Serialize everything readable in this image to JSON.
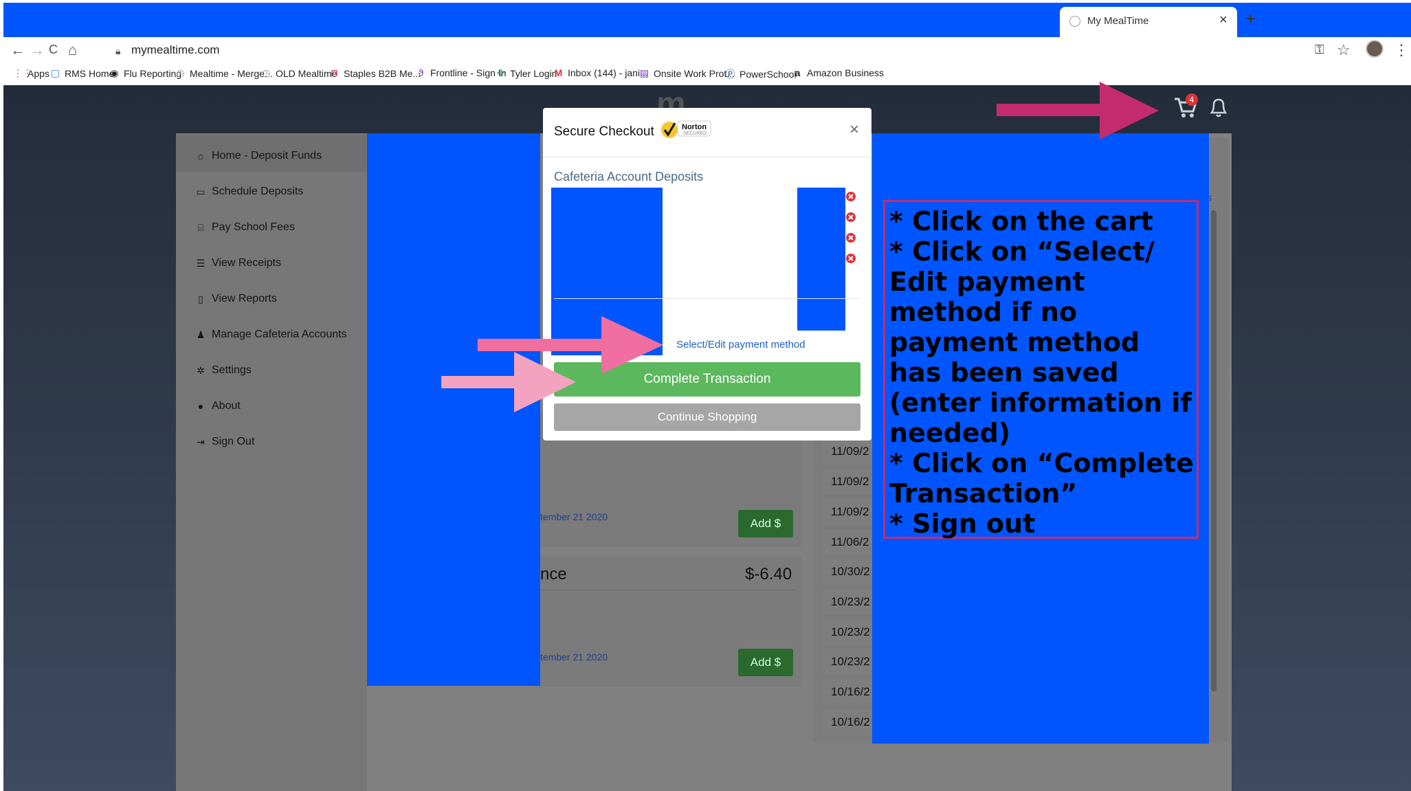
{
  "browser": {
    "tab_title": "My MealTime",
    "tab_close": "×",
    "new_tab": "+",
    "url": "mymealtime.com",
    "nav": {
      "back": "←",
      "forward": "→",
      "reload": "C",
      "home": "⌂"
    },
    "bookmarks": [
      {
        "label": "Apps",
        "icon": "apps-grid-icon"
      },
      {
        "label": "RMS Home",
        "icon": "page-icon"
      },
      {
        "label": "Flu Reporting",
        "icon": "globe-icon"
      },
      {
        "label": "Mealtime - Merge...",
        "icon": "clock-icon"
      },
      {
        "label": "OLD Mealtime",
        "icon": "clock-icon"
      },
      {
        "label": "Staples B2B Me...",
        "icon": "staples-icon"
      },
      {
        "label": "Frontline - Sign In",
        "icon": "frontline-icon"
      },
      {
        "label": "Tyler Login",
        "icon": "tyler-icon"
      },
      {
        "label": "Inbox (144) - jani...",
        "icon": "gmail-icon"
      },
      {
        "label": "Onsite Work Prot...",
        "icon": "forms-icon"
      },
      {
        "label": "PowerSchool",
        "icon": "powerschool-icon"
      },
      {
        "label": "Amazon Business",
        "icon": "amazon-icon"
      }
    ]
  },
  "header": {
    "logo": "m",
    "cart_count": "4"
  },
  "sidebar": {
    "items": [
      {
        "label": "Home - Deposit Funds",
        "icon": "home-icon"
      },
      {
        "label": "Schedule Deposits",
        "icon": "credit-card-icon"
      },
      {
        "label": "Pay School Fees",
        "icon": "bank-icon"
      },
      {
        "label": "View Receipts",
        "icon": "list-icon"
      },
      {
        "label": "View Reports",
        "icon": "document-icon"
      },
      {
        "label": "Manage Cafeteria Accounts",
        "icon": "user-icon"
      },
      {
        "label": "Settings",
        "icon": "gear-icon"
      },
      {
        "label": "About",
        "icon": "question-icon"
      },
      {
        "label": "Sign Out",
        "icon": "sign-out-icon"
      }
    ]
  },
  "main": {
    "card1": {
      "date": "tember 21 2020",
      "add_label": "Add $"
    },
    "card2": {
      "name": "nce",
      "balance": "$-6.40",
      "date": "tember 21 2020",
      "add_label": "Add $"
    },
    "partial_link": "ts",
    "dates": [
      "11/09/2",
      "11/09/2",
      "11/09/2",
      "11/06/2",
      "10/30/2",
      "10/23/2",
      "10/23/2",
      "10/23/2",
      "10/16/2",
      "10/16/2"
    ]
  },
  "modal": {
    "title": "Secure Checkout",
    "norton_label": "Norton",
    "norton_sub": "SECURED",
    "close": "×",
    "section_title": "Cafeteria Account Deposits",
    "select_payment": "Select/Edit payment method",
    "complete_button": "Complete Transaction",
    "continue_button": "Continue Shopping"
  },
  "annotation": {
    "lines": [
      "* Click on the cart",
      "* Click on “Select/ Edit payment method if no payment method has been saved (enter information if needed)",
      "* Click on “Complete Transaction”",
      "* Sign out"
    ]
  },
  "colors": {
    "redaction_blue": "#0055ff",
    "arrow_magenta": "#c42c6f",
    "arrow_pink": "#f3a3c0",
    "complete_green": "#5cb85c"
  }
}
